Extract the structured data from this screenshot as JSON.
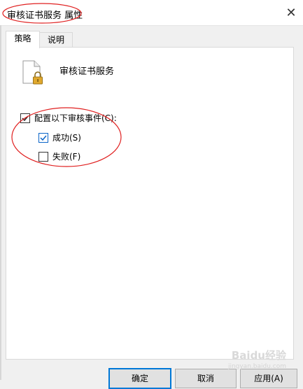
{
  "window": {
    "title": "审核证书服务 属性",
    "close_label": "✕"
  },
  "tabs": [
    {
      "label": "策略",
      "active": true
    },
    {
      "label": "说明",
      "active": false
    }
  ],
  "policy": {
    "service_name": "审核证书服务",
    "configure": {
      "label": "配置以下审核事件(C):",
      "checked": true
    },
    "success": {
      "label": "成功(S)",
      "checked": true
    },
    "failure": {
      "label": "失败(F)",
      "checked": false
    }
  },
  "buttons": {
    "ok": "确定",
    "cancel": "取消",
    "apply": "应用(A)"
  },
  "watermark": {
    "brand": "Baidu经验",
    "url": "jingyan.baidu.com"
  },
  "colors": {
    "annotation": "#e02020",
    "focus_border": "#0078d7",
    "check": "#0a64c8"
  }
}
